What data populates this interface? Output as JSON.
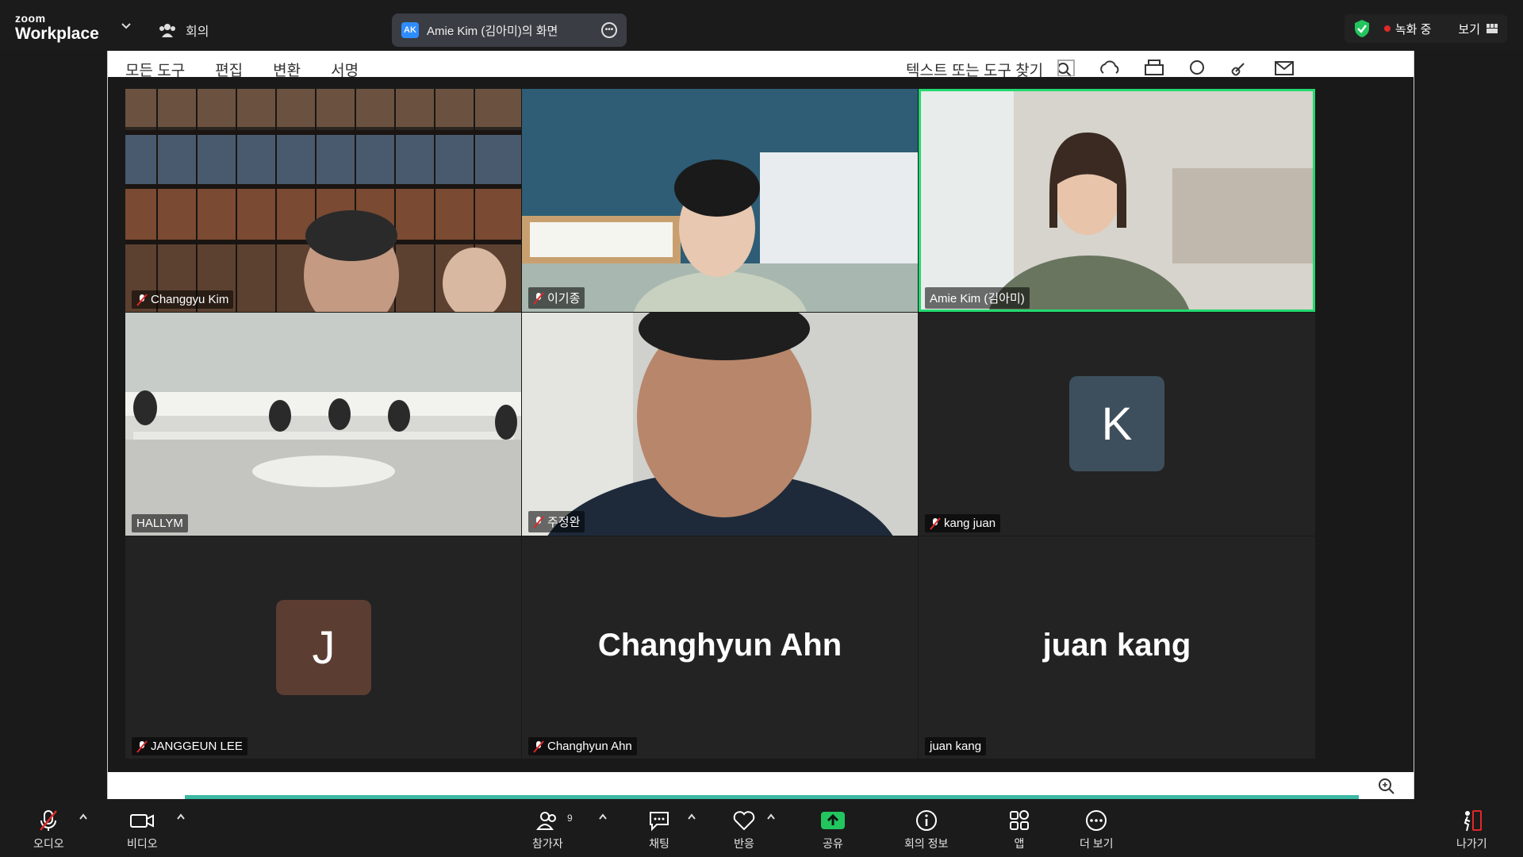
{
  "app": {
    "brand_top": "zoom",
    "brand_bottom": "Workplace"
  },
  "topbar": {
    "meeting_label": "회의",
    "share_badge": "AK",
    "share_title": "Amie Kim (김아미)의 화면",
    "recording_label": "녹화 중",
    "view_label": "보기"
  },
  "pdf": {
    "menu": [
      "모든 도구",
      "편집",
      "변환",
      "서명"
    ],
    "search_placeholder": "텍스트 또는 도구 찾기"
  },
  "participants": [
    {
      "name": "Changgyu Kim",
      "muted": true,
      "video": "library"
    },
    {
      "name": "이기종",
      "muted": true,
      "video": "office"
    },
    {
      "name": "Amie Kim (김아미)",
      "muted": false,
      "video": "speaker",
      "active_speaker": true
    },
    {
      "name": "HALLYM",
      "muted": false,
      "video": "room"
    },
    {
      "name": "주정완",
      "muted": true,
      "video": "closeup"
    },
    {
      "name": "kang juan",
      "muted": true,
      "avatar_letter": "K",
      "avatar_color": "#3d4f5c"
    },
    {
      "name": "JANGGEUN LEE",
      "muted": true,
      "avatar_letter": "J",
      "avatar_color": "#5c3d32"
    },
    {
      "name": "Changhyun Ahn",
      "muted": true,
      "display_name": "Changhyun Ahn"
    },
    {
      "name": "juan kang",
      "muted": false,
      "display_name": "juan kang"
    }
  ],
  "toolbar": {
    "audio": "오디오",
    "video": "비디오",
    "participants": "참가자",
    "participants_count": "9",
    "chat": "채팅",
    "reactions": "반응",
    "share": "공유",
    "info": "회의 정보",
    "apps": "앱",
    "more": "더 보기",
    "leave": "나가기"
  },
  "colors": {
    "accent_green": "#23d96f",
    "recording_red": "#e02828",
    "share_green": "#22c55e",
    "leave_red": "#e02828"
  }
}
